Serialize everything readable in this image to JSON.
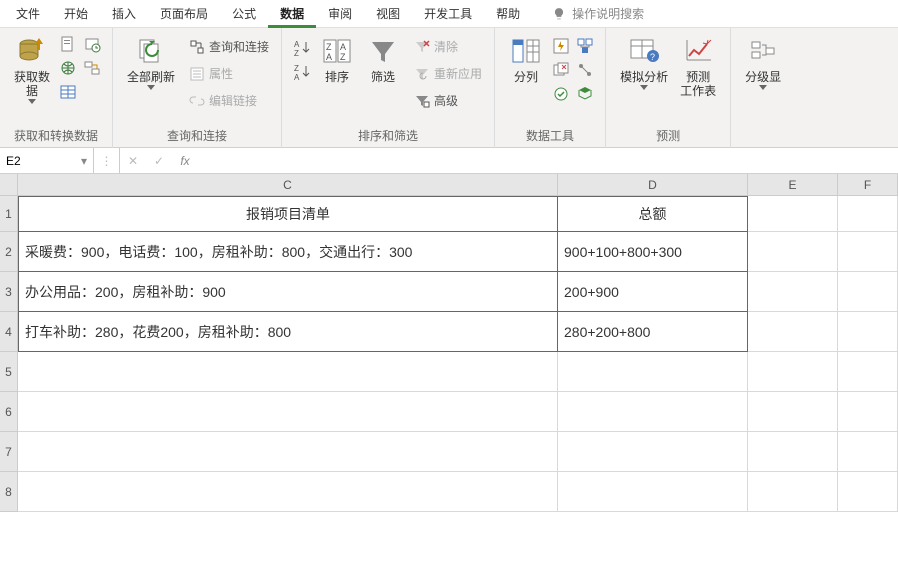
{
  "menu": {
    "tabs": [
      "文件",
      "开始",
      "插入",
      "页面布局",
      "公式",
      "数据",
      "审阅",
      "视图",
      "开发工具",
      "帮助"
    ],
    "active_index": 5,
    "help_search": "操作说明搜索"
  },
  "ribbon": {
    "group1": {
      "btn": "获取数\n据",
      "label": "获取和转换数据"
    },
    "group2": {
      "btn": "全部刷新",
      "items": [
        "查询和连接",
        "属性",
        "编辑链接"
      ],
      "label": "查询和连接"
    },
    "group3": {
      "sort": "排序",
      "filter": "筛选",
      "clear": "清除",
      "reapply": "重新应用",
      "advanced": "高级",
      "label": "排序和筛选"
    },
    "group4": {
      "btn": "分列",
      "label": "数据工具"
    },
    "group5": {
      "whatif": "模拟分析",
      "forecast": "预测\n工作表",
      "label": "预测"
    },
    "group6": {
      "btn": "分级显"
    }
  },
  "formula_bar": {
    "name": "E2",
    "value": ""
  },
  "sheet": {
    "cols": [
      "C",
      "D",
      "E",
      "F"
    ],
    "rows": [
      "1",
      "2",
      "3",
      "4",
      "5",
      "6",
      "7",
      "8"
    ],
    "header_c": "报销项目清单",
    "header_d": "总额",
    "data": [
      {
        "c": "采暖费：900，电话费：100，房租补助：800，交通出行：300",
        "d": "900+100+800+300"
      },
      {
        "c": "办公用品：200，房租补助：900",
        "d": "200+900"
      },
      {
        "c": "打车补助：280，花费200，房租补助：800",
        "d": "280+200+800"
      }
    ]
  }
}
